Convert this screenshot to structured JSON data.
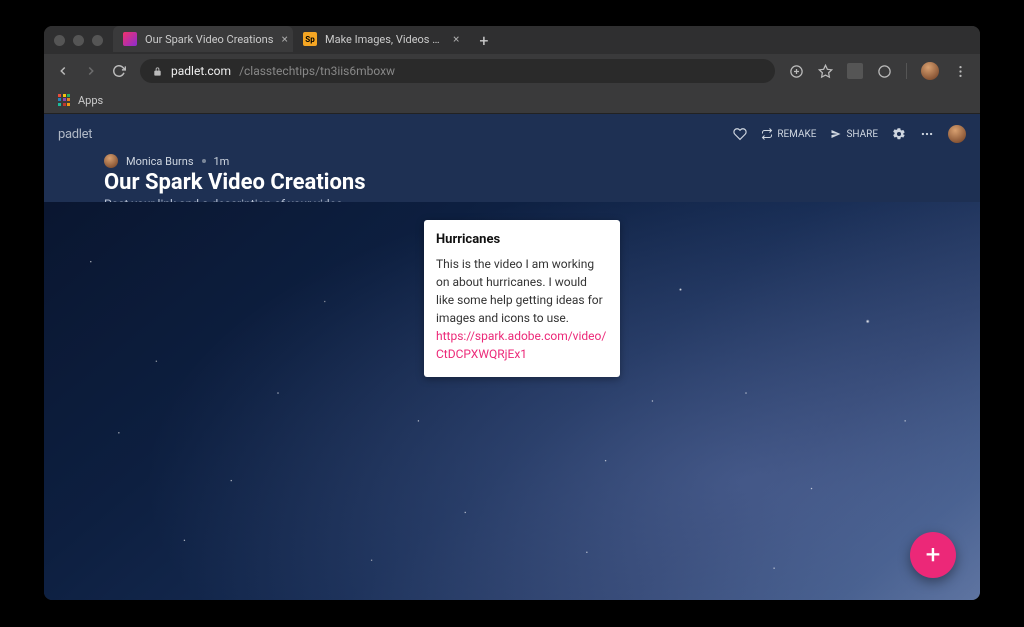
{
  "browser": {
    "tabs": [
      {
        "title": "Our Spark Video Creations",
        "active": true
      },
      {
        "title": "Make Images, Videos and Web",
        "active": false
      }
    ],
    "url_host": "padlet.com",
    "url_path": "/classtechtips/tn3iis6mboxw",
    "bookmarks": {
      "apps_label": "Apps"
    }
  },
  "padlet": {
    "logo": "padlet",
    "actions": {
      "remake": "REMAKE",
      "share": "SHARE"
    },
    "author": "Monica Burns",
    "age": "1m",
    "title": "Our Spark Video Creations",
    "subtitle": "Post your link and a description of your video.",
    "post": {
      "title": "Hurricanes",
      "body": "This is the video I am working on about hurricanes. I would like some help getting ideas for images and icons to use.",
      "link_text": "https://spark.adobe.com/video/CtDCPXWQRjEx1"
    },
    "fab": "+"
  }
}
